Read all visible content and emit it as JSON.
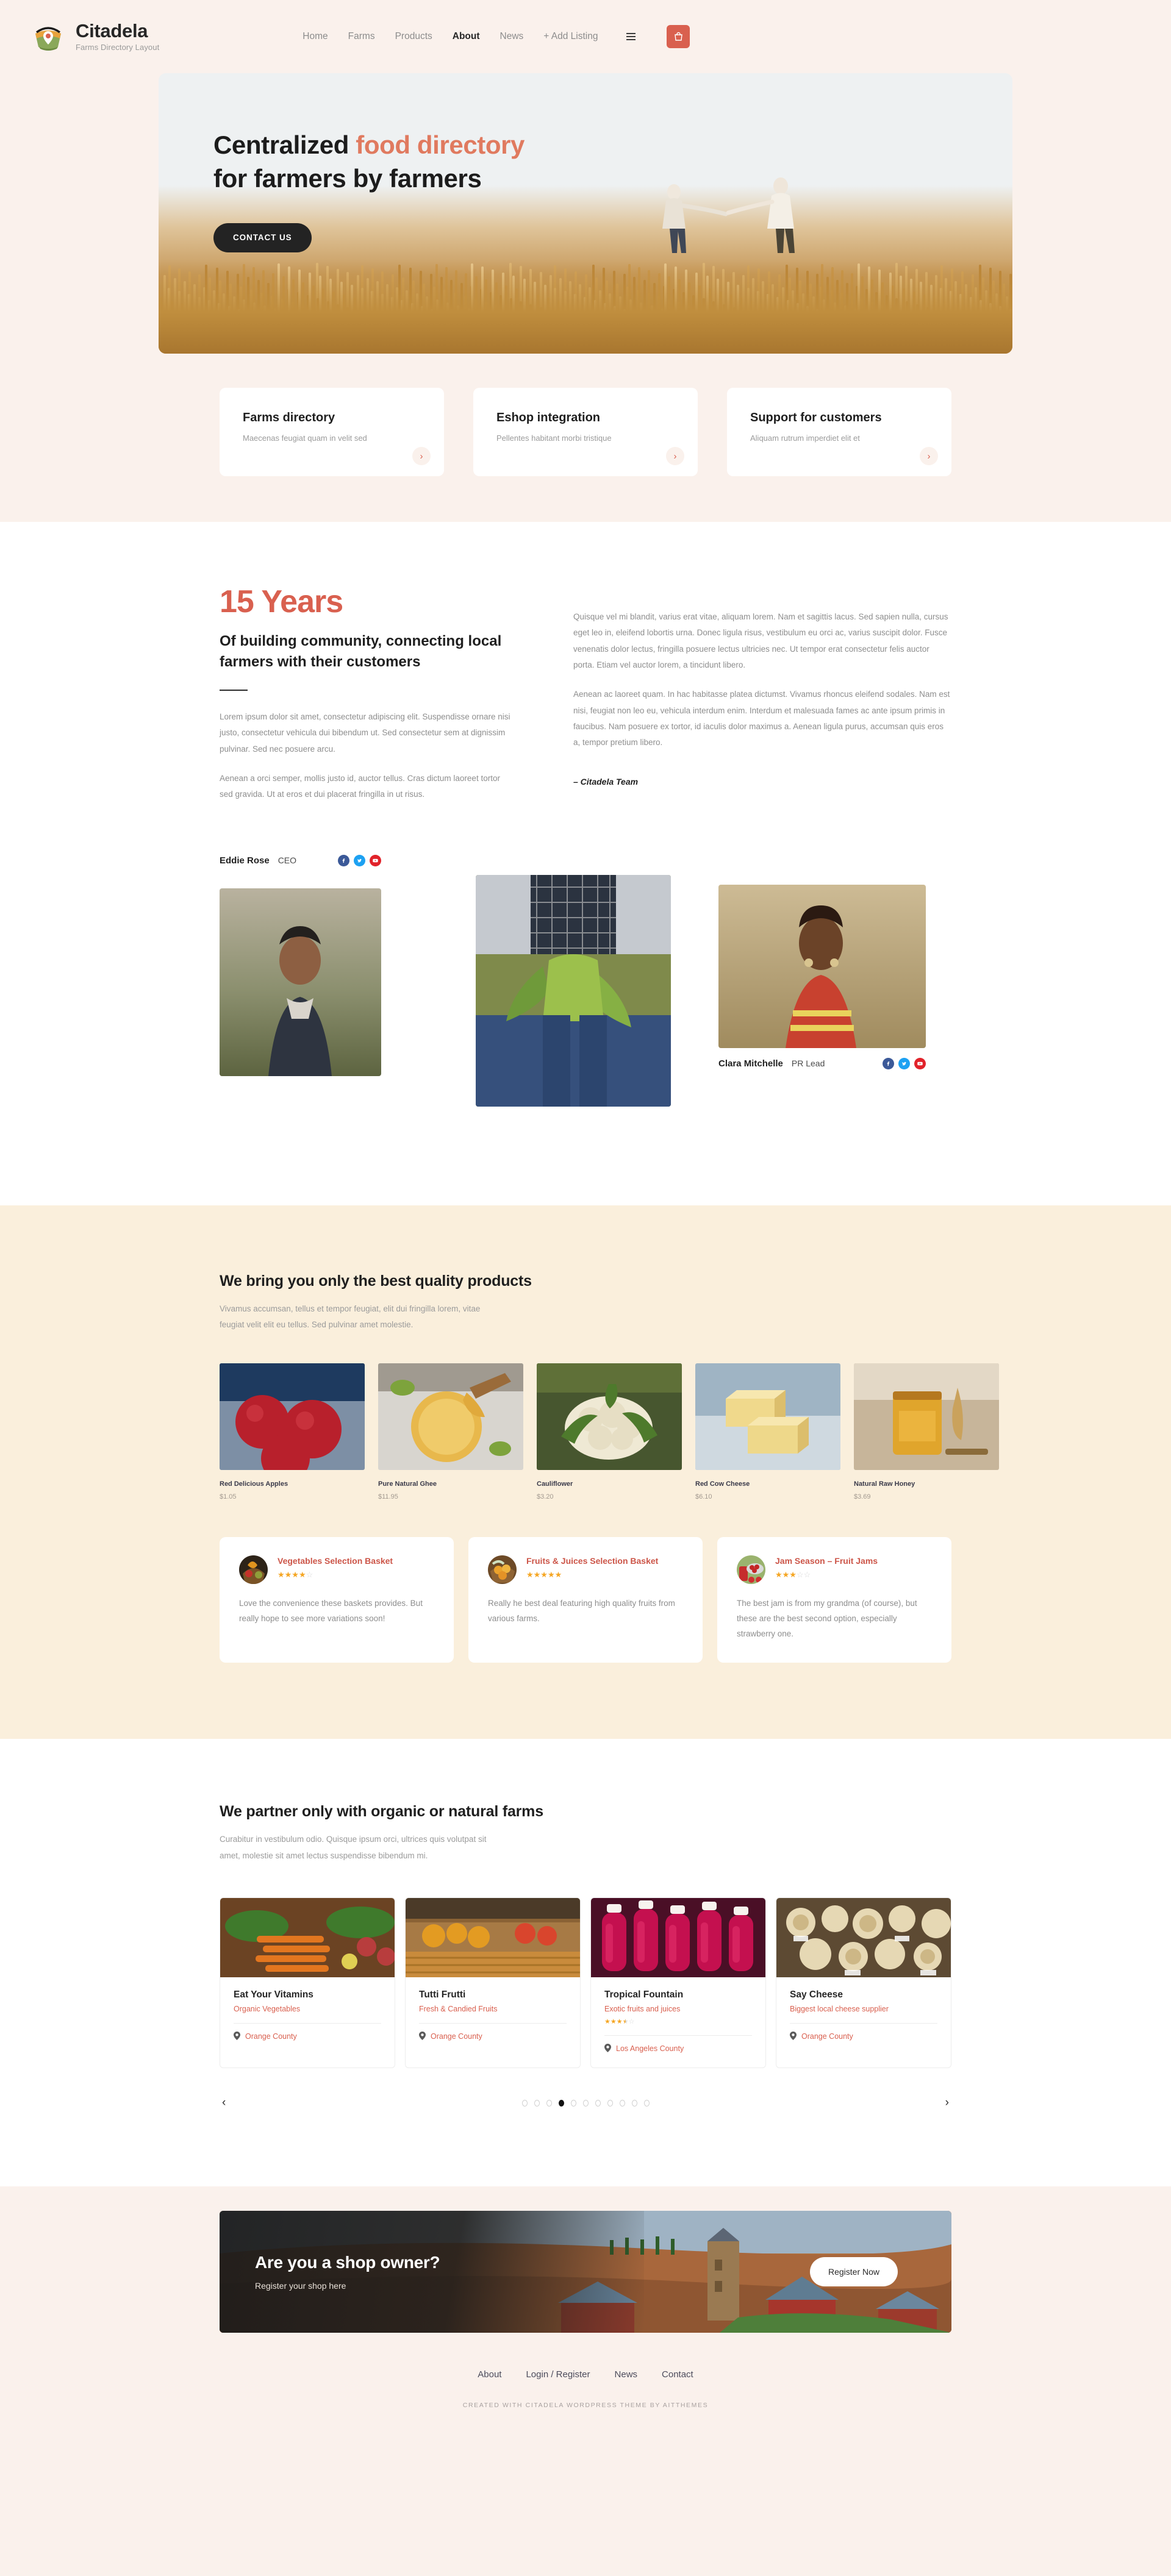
{
  "header": {
    "brand_title": "Citadela",
    "brand_subtitle": "Farms Directory Layout",
    "logo_icon": "farm-basket-pin-logo",
    "nav": [
      {
        "label": "Home",
        "active": false
      },
      {
        "label": "Farms",
        "active": false
      },
      {
        "label": "Products",
        "active": false
      },
      {
        "label": "About",
        "active": true
      },
      {
        "label": "News",
        "active": false
      },
      {
        "label": "+ Add Listing",
        "active": false
      }
    ],
    "menu_icon": "hamburger-icon",
    "cart_icon": "shopping-bag-icon",
    "cart_color": "#d9604f"
  },
  "hero": {
    "title_part1": "Centralized ",
    "title_accent": "food directory",
    "title_part2": "for farmers by farmers",
    "button_label": "CONTACT US",
    "accent_color": "#e07a5f"
  },
  "features": [
    {
      "title": "Farms directory",
      "desc": "Maecenas feugiat quam in velit sed",
      "arrow_icon": "chevron-right-icon"
    },
    {
      "title": "Eshop integration",
      "desc": "Pellentes habitant morbi tristique",
      "arrow_icon": "chevron-right-icon"
    },
    {
      "title": "Support for customers",
      "desc": "Aliquam rutrum imperdiet elit et",
      "arrow_icon": "chevron-right-icon"
    }
  ],
  "about": {
    "years": "15 Years",
    "heading": "Of building community, connecting local farmers with their customers",
    "p1": "Lorem ipsum dolor sit amet, consectetur adipiscing elit. Suspendisse ornare nisi justo, consectetur vehicula dui bibendum ut. Sed consectetur sem at dignissim pulvinar. Sed nec posuere arcu.",
    "p2": "Aenean a orci semper, mollis justo id, auctor tellus. Cras dictum laoreet tortor sed gravida. Ut at eros et dui placerat fringilla in ut risus.",
    "p3": "Quisque vel mi blandit, varius erat vitae, aliquam lorem. Nam et sagittis lacus. Sed sapien nulla, cursus eget leo in, eleifend lobortis urna. Donec ligula risus, vestibulum eu orci ac, varius suscipit dolor. Fusce venenatis dolor lectus, fringilla posuere lectus ultricies nec. Ut tempor erat consectetur felis auctor porta. Etiam vel auctor lorem, a tincidunt libero.",
    "p4": "Aenean ac laoreet quam. In hac habitasse platea dictumst. Vivamus rhoncus eleifend sodales. Nam est nisi, feugiat non leo eu, vehicula interdum enim. Interdum et malesuada fames ac ante ipsum primis in faucibus. Nam posuere ex tortor, id iaculis dolor maximus a. Aenean ligula purus, accumsan quis eros a, tempor pretium libero.",
    "signature": "– Citadela Team"
  },
  "team": [
    {
      "name": "Eddie Rose",
      "role": "CEO",
      "socials": [
        "facebook-icon",
        "twitter-icon",
        "youtube-icon"
      ]
    },
    {
      "name": "Clara Mitchelle",
      "role": "PR Lead",
      "socials": [
        "facebook-icon",
        "twitter-icon",
        "youtube-icon"
      ]
    }
  ],
  "products_section": {
    "heading": "We bring you only the best quality products",
    "subtitle": "Vivamus accumsan, tellus et tempor feugiat, elit dui fringilla lorem, vitae feugiat velit elit eu tellus. Sed pulvinar amet molestie.",
    "products": [
      {
        "name": "Red Delicious Apples",
        "price": "$1.05"
      },
      {
        "name": "Pure Natural Ghee",
        "price": "$11.95"
      },
      {
        "name": "Cauliflower",
        "price": "$3.20"
      },
      {
        "name": "Red Cow Cheese",
        "price": "$6.10"
      },
      {
        "name": "Natural Raw Honey",
        "price": "$3.69"
      }
    ],
    "testimonials": [
      {
        "title": "Vegetables Selection Basket",
        "rating": 4,
        "max_rating": 5,
        "body": "Love the convenience these baskets provides. But really hope to see more variations soon!"
      },
      {
        "title": "Fruits & Juices Selection Basket",
        "rating": 5,
        "max_rating": 5,
        "body": "Really he best deal featuring high quality fruits from various farms."
      },
      {
        "title": "Jam Season – Fruit Jams",
        "rating": 3,
        "max_rating": 5,
        "body": "The best jam is from my grandma (of course), but these are the best second option, especially strawberry one."
      }
    ]
  },
  "farms_section": {
    "heading": "We partner only with organic or natural farms",
    "subtitle": "Curabitur in vestibulum odio. Quisque ipsum orci, ultrices quis volutpat sit amet, molestie sit amet lectus suspendisse bibendum mi.",
    "farms": [
      {
        "name": "Eat Your Vitamins",
        "tagline": "Organic Vegetables",
        "location": "Orange County",
        "rating": 0
      },
      {
        "name": "Tutti Frutti",
        "tagline": "Fresh & Candied Fruits",
        "location": "Orange County",
        "rating": 0
      },
      {
        "name": "Tropical Fountain",
        "tagline": "Exotic fruits and juices",
        "location": "Los Angeles County",
        "rating": 3.5
      },
      {
        "name": "Say Cheese",
        "tagline": "Biggest local cheese supplier",
        "location": "Orange County",
        "rating": 0
      }
    ],
    "location_icon": "map-pin-icon",
    "prev_icon": "chevron-left-icon",
    "next_icon": "chevron-right-icon",
    "dots_total": 11,
    "dots_active_index": 3
  },
  "cta": {
    "heading": "Are you a shop owner?",
    "subtitle": "Register your shop here",
    "button_label": "Register Now"
  },
  "footer": {
    "nav": [
      "About",
      "Login / Register",
      "News",
      "Contact"
    ],
    "credit": "CREATED WITH CITADELA WORDPRESS THEME BY AITTHEMES"
  }
}
